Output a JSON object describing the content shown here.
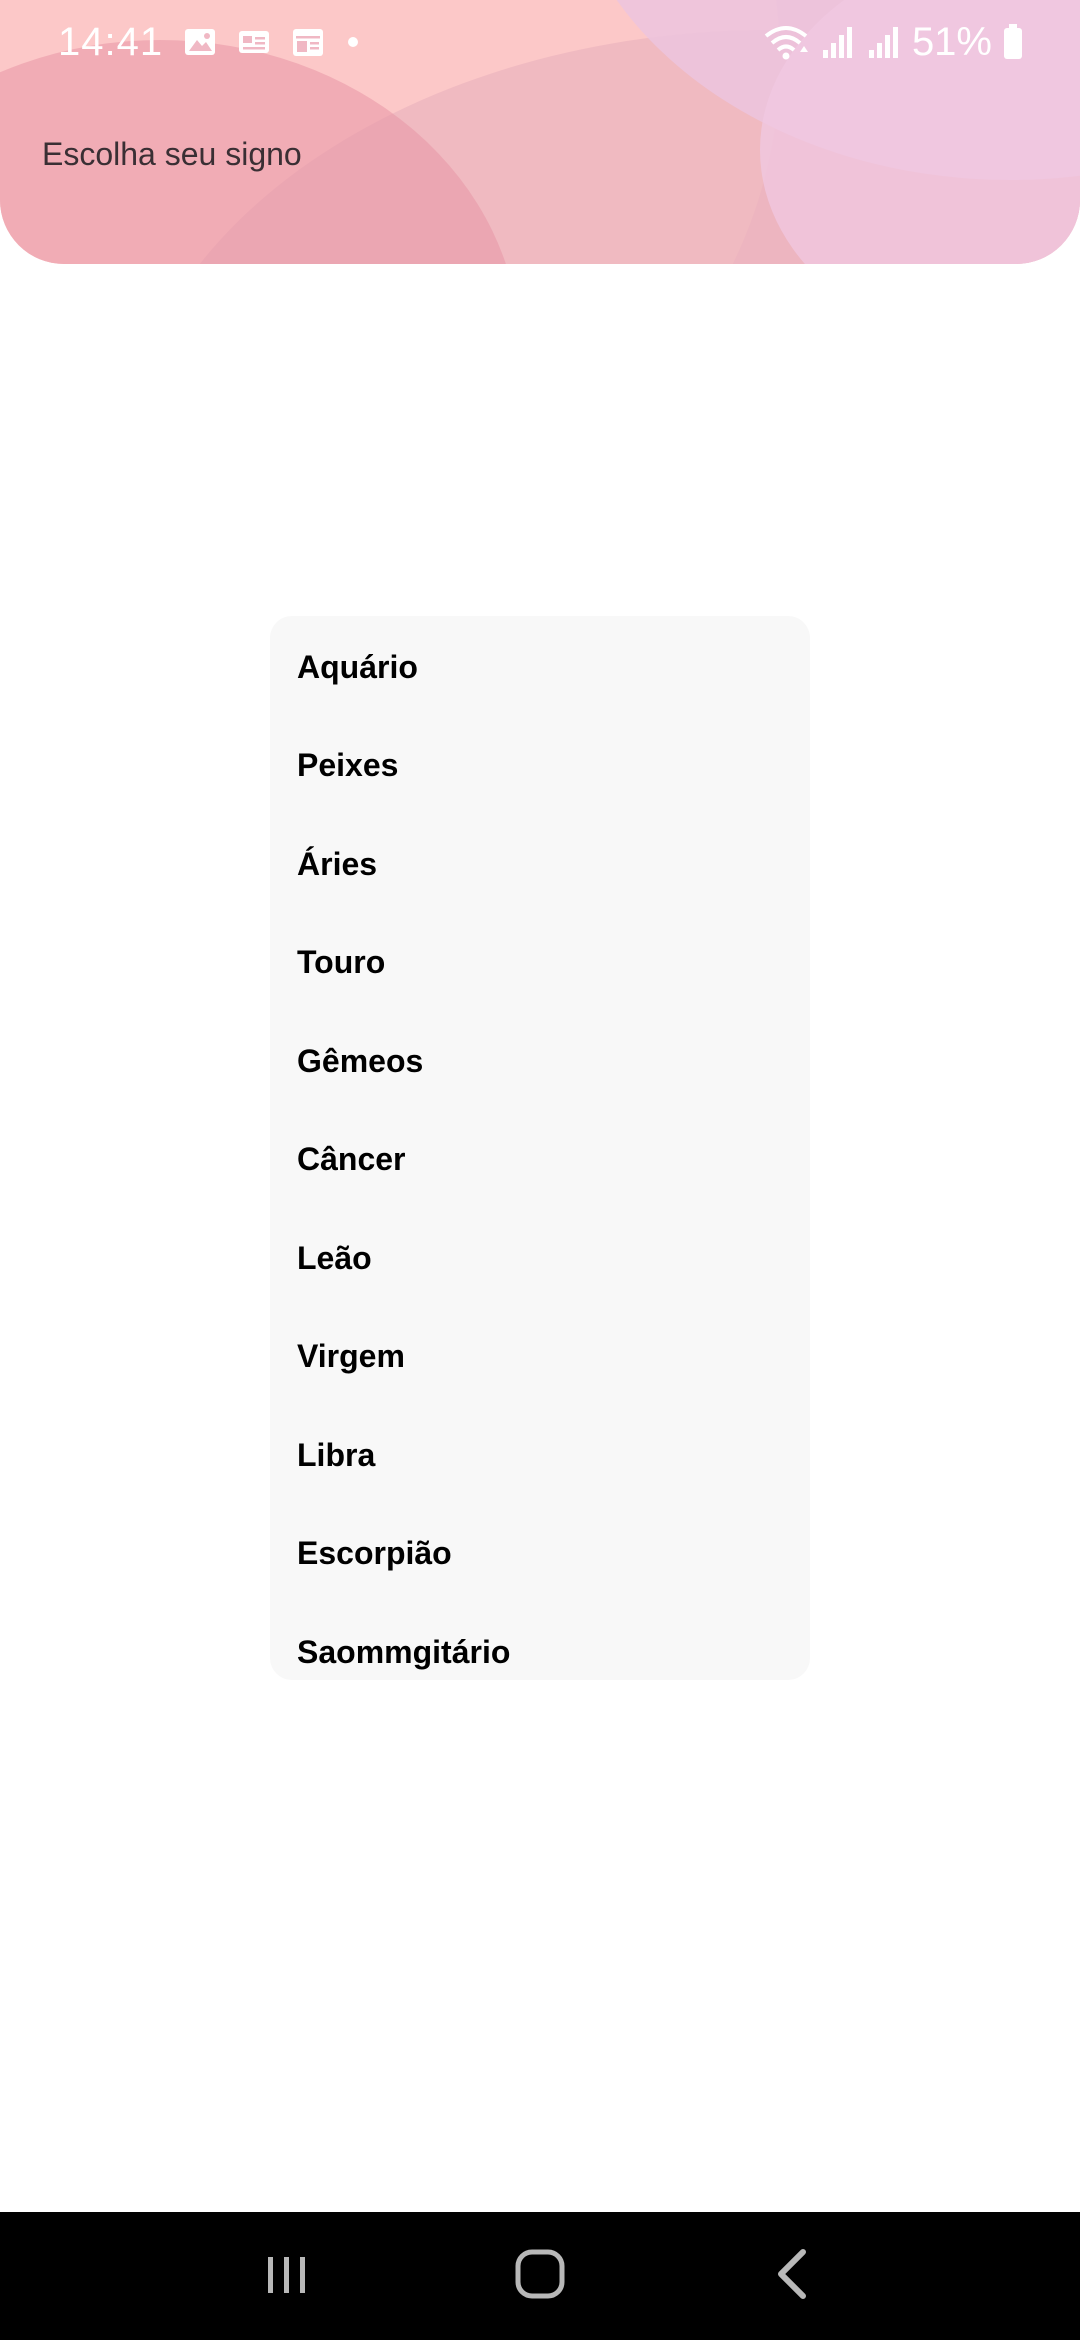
{
  "status_bar": {
    "time": "14:41",
    "battery": "51%",
    "icons": [
      "gallery-icon",
      "id-card-icon",
      "calendar-icon",
      "notification-dot-icon",
      "wifi-icon",
      "signal-icon",
      "signal-icon",
      "battery-icon"
    ]
  },
  "header": {
    "title": "Escolha seu signo"
  },
  "signs": [
    "Aquário",
    "Peixes",
    "Áries",
    "Touro",
    "Gêmeos",
    "Câncer",
    "Leão",
    "Virgem",
    "Libra",
    "Escorpião",
    "Saommgitário"
  ],
  "navigation": {
    "icons": [
      "recent-apps-icon",
      "home-icon",
      "back-icon"
    ]
  },
  "colors": {
    "header_base": "#f2b8c5",
    "list_background": "#f8f8f8",
    "nav_background": "#000000"
  }
}
